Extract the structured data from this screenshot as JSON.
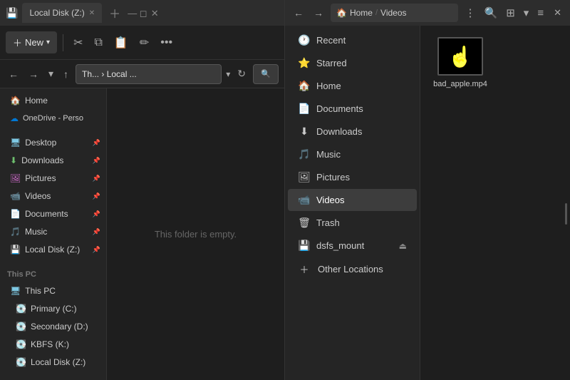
{
  "left_window": {
    "title": "Local Disk (Z:)",
    "tab_label": "Local Disk (Z:)",
    "new_button": "New",
    "toolbar_buttons": [
      "cut",
      "copy",
      "paste",
      "rename",
      "more"
    ],
    "address_path": "Th... › Local ...",
    "empty_message": "This folder is empty.",
    "sidebar": {
      "items": [
        {
          "id": "home",
          "label": "Home",
          "icon": "🏠",
          "icon_class": "icon-home"
        },
        {
          "id": "onedrive",
          "label": "OneDrive - Perso",
          "icon": "☁",
          "icon_class": "icon-onedrive"
        },
        {
          "id": "desktop",
          "label": "Desktop",
          "icon": "🖥",
          "icon_class": "icon-desktop",
          "pinned": true
        },
        {
          "id": "downloads",
          "label": "Downloads",
          "icon": "⬇",
          "icon_class": "icon-downloads",
          "pinned": true
        },
        {
          "id": "pictures",
          "label": "Pictures",
          "icon": "🖼",
          "icon_class": "icon-pictures",
          "pinned": true
        },
        {
          "id": "videos",
          "label": "Videos",
          "icon": "📹",
          "icon_class": "icon-videos",
          "pinned": true
        },
        {
          "id": "documents",
          "label": "Documents",
          "icon": "📄",
          "icon_class": "icon-documents",
          "pinned": true
        },
        {
          "id": "music",
          "label": "Music",
          "icon": "🎵",
          "icon_class": "icon-music",
          "pinned": true
        },
        {
          "id": "localdisk",
          "label": "Local Disk (Z:)",
          "icon": "💾",
          "icon_class": "icon-disk",
          "pinned": true
        }
      ],
      "section_this_pc": "This PC",
      "drives": [
        {
          "id": "primary",
          "label": "Primary (C:)",
          "icon": "💽"
        },
        {
          "id": "secondary",
          "label": "Secondary (D:)",
          "icon": "💽"
        },
        {
          "id": "kbfs",
          "label": "KBFS (K:)",
          "icon": "💽"
        },
        {
          "id": "localdisk_drive",
          "label": "Local Disk (Z:)",
          "icon": "💽"
        }
      ]
    }
  },
  "right_window": {
    "breadcrumb_home": "Home",
    "breadcrumb_sep": "/",
    "breadcrumb_current": "Videos",
    "nav_sidebar": {
      "items": [
        {
          "id": "recent",
          "label": "Recent",
          "icon": "🕐",
          "active": false
        },
        {
          "id": "starred",
          "label": "Starred",
          "icon": "⭐",
          "active": false
        },
        {
          "id": "home",
          "label": "Home",
          "icon": "🏠",
          "active": false
        },
        {
          "id": "documents",
          "label": "Documents",
          "icon": "📄",
          "active": false
        },
        {
          "id": "downloads",
          "label": "Downloads",
          "icon": "⬇",
          "active": false
        },
        {
          "id": "music",
          "label": "Music",
          "icon": "🎵",
          "active": false
        },
        {
          "id": "pictures",
          "label": "Pictures",
          "icon": "🖼",
          "active": false
        },
        {
          "id": "videos",
          "label": "Videos",
          "icon": "📹",
          "active": true
        },
        {
          "id": "trash",
          "label": "Trash",
          "icon": "🗑",
          "active": false
        },
        {
          "id": "dsfs_mount",
          "label": "dsfs_mount",
          "icon": "💾",
          "active": false,
          "eject": true
        },
        {
          "id": "other_locations",
          "label": "Other Locations",
          "icon": "+",
          "active": false
        }
      ]
    },
    "file": {
      "name": "bad_apple.mp4",
      "thumbnail_icon": "👆"
    }
  }
}
